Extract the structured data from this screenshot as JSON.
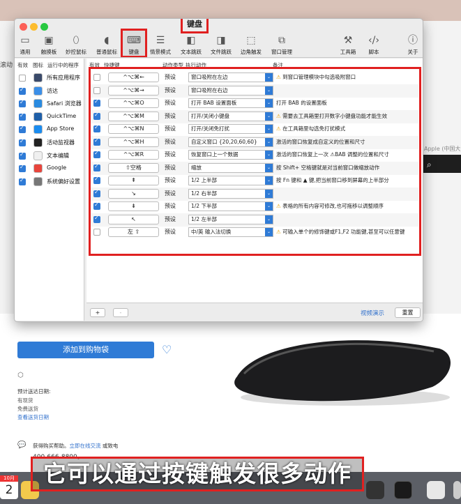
{
  "background": {
    "left_text": "滚动",
    "apple_crumb": "Apple (中国大",
    "add_to_cart": "添加到购物袋",
    "delivery_label": "预计送达日期:",
    "stock": "有现货",
    "shipping": "免费送货",
    "view_delivery": "查看送货日期",
    "help_text": "获得购买帮助。",
    "help_link": "立即在线交流",
    "help_tail": " 或致电",
    "phone": "400-666-8800。",
    "calendar": {
      "month": "10月",
      "day": "2"
    },
    "caption": "它可以通过按键触发很多动作"
  },
  "window": {
    "title": "键盘",
    "toolbar": [
      {
        "label": "通用",
        "icon": "monitor-icon"
      },
      {
        "label": "触摸板",
        "icon": "trackpad-icon"
      },
      {
        "label": "妙控鼠标",
        "icon": "magic-mouse-icon"
      },
      {
        "label": "普通鼠标",
        "icon": "mouse-icon"
      },
      {
        "label": "键盘",
        "icon": "keyboard-icon"
      },
      {
        "label": "情景模式",
        "icon": "sliders-icon"
      },
      {
        "label": "文本跳跃",
        "icon": "text-jump-icon"
      },
      {
        "label": "文件跳跃",
        "icon": "file-jump-icon"
      },
      {
        "label": "边角触发",
        "icon": "corner-icon"
      },
      {
        "label": "窗口管理",
        "icon": "window-icon"
      },
      {
        "label": "工具箱",
        "icon": "toolbox-icon"
      },
      {
        "label": "脚本",
        "icon": "script-icon"
      },
      {
        "label": "关于",
        "icon": "info-icon"
      }
    ],
    "left_headers": {
      "enabled": "有效",
      "icon": "图标",
      "running": "运行中的程序"
    },
    "apps": [
      {
        "name": "所有应用程序",
        "enabled": false,
        "color": "#3a4a6a"
      },
      {
        "name": "访达",
        "enabled": true,
        "color": "#3b8fe8"
      },
      {
        "name": "Safari 浏览器",
        "enabled": true,
        "color": "#2a8be0"
      },
      {
        "name": "QuickTime",
        "enabled": true,
        "color": "#1f5fa8"
      },
      {
        "name": "App Store",
        "enabled": true,
        "color": "#1a8cf0"
      },
      {
        "name": "活动监视器",
        "enabled": true,
        "color": "#222222"
      },
      {
        "name": "文本编辑",
        "enabled": true,
        "color": "#f0f0f0"
      },
      {
        "name": "Google",
        "enabled": true,
        "color": "#e8453c"
      },
      {
        "name": "系统偏好设置",
        "enabled": true,
        "color": "#777777"
      }
    ],
    "table_headers": {
      "enabled": "有效",
      "shortcut": "快捷键",
      "type": "动作类型",
      "action": "执行动作",
      "note": "备注"
    },
    "shortcuts": [
      {
        "enabled": false,
        "key": "^⌥⌘←",
        "type": "预设",
        "action": "窗口吸附在左边",
        "warn": true,
        "note": "到窗口管理模块中勾选吸附窗口"
      },
      {
        "enabled": false,
        "key": "^⌥⌘→",
        "type": "预设",
        "action": "窗口吸附在右边",
        "warn": false,
        "note": ""
      },
      {
        "enabled": true,
        "key": "^⌥⌘O",
        "type": "预设",
        "action": "打开 BAB 设置面板",
        "warn": false,
        "note": "打开 BAB 的设置面板"
      },
      {
        "enabled": true,
        "key": "^⌥⌘M",
        "type": "预设",
        "action": "打开/关闭小键盘",
        "warn": true,
        "note": "需要去工具箱里打开数字小键盘功能才能生效"
      },
      {
        "enabled": true,
        "key": "^⌥⌘N",
        "type": "预设",
        "action": "打开/关闭免打扰",
        "warn": true,
        "note": "在工具箱里勾选免打扰模式"
      },
      {
        "enabled": true,
        "key": "^⌥⌘H",
        "type": "预设",
        "action": "自定义窗口 {20,20,60,60}",
        "warn": false,
        "note": "激活的窗口恢复成自定义的位置和尺寸"
      },
      {
        "enabled": true,
        "key": "^⌥⌘R",
        "type": "预设",
        "action": "恢复窗口上一个数据",
        "warn": false,
        "note": "激活的窗口恢复上一次 ⚠BAB 调整的位置和尺寸"
      },
      {
        "enabled": true,
        "key": "⇧空格",
        "type": "预设",
        "action": "缩放",
        "warn": false,
        "note": "按 Shift+ 空格键就是对当前窗口做缩放动作"
      },
      {
        "enabled": true,
        "key": "⇞",
        "type": "预设",
        "action": "1/2 上半部",
        "warn": false,
        "note": "按 Fn 键和 ▲ 键,把当前窗口移到屏幕的上半部分"
      },
      {
        "enabled": true,
        "key": "↘",
        "type": "预设",
        "action": "1/2 右半部",
        "warn": false,
        "note": ""
      },
      {
        "enabled": true,
        "key": "⇟",
        "type": "预设",
        "action": "1/2 下半部",
        "warn": true,
        "note": "表格的所有内容可修改,也可拖移以调整顺序"
      },
      {
        "enabled": true,
        "key": "↖",
        "type": "预设",
        "action": "1/2 左半部",
        "warn": false,
        "note": ""
      },
      {
        "enabled": false,
        "key": "左 ⇧",
        "type": "预设",
        "action": "中/英 输入法切换",
        "warn": true,
        "note": "可输入单个的修饰键或F1,F2 功能键,甚至可以任意键"
      }
    ],
    "add_label": "+",
    "remove_label": "-",
    "video_demo": "视频演示",
    "reset": "重置"
  }
}
